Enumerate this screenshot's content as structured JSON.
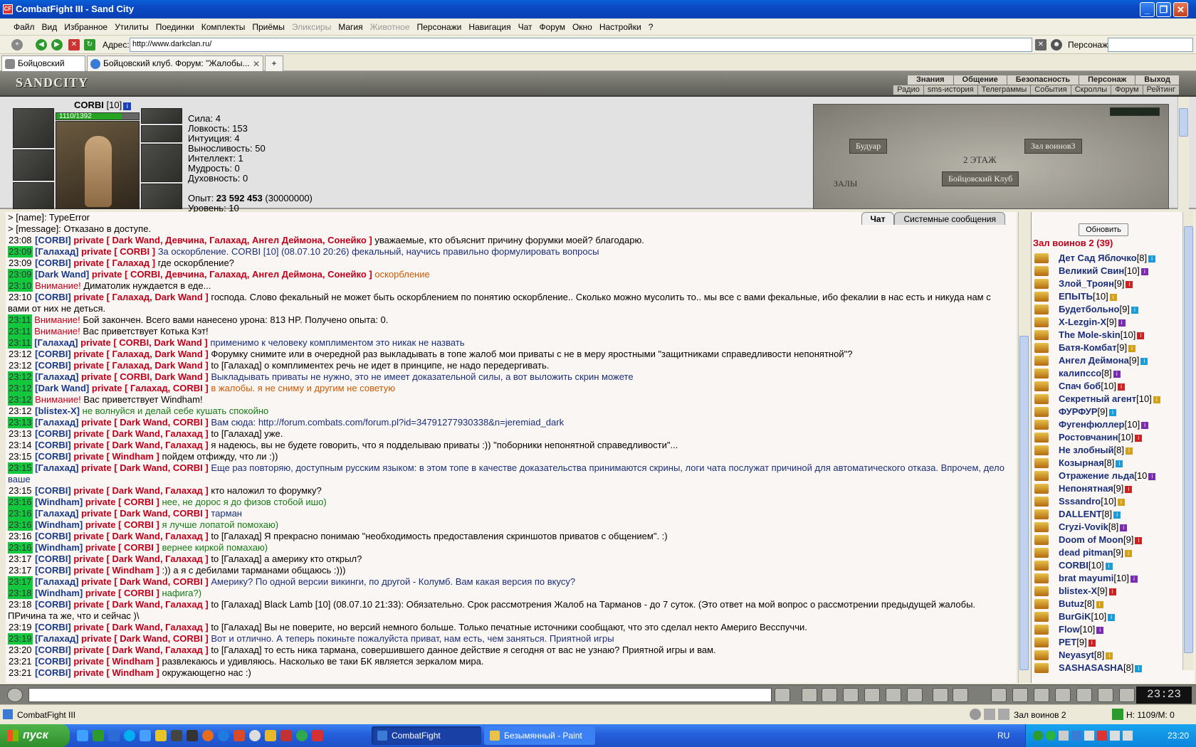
{
  "window": {
    "title": "CombatFight III - Sand City"
  },
  "menu": [
    {
      "label": "Файл"
    },
    {
      "label": "Вид"
    },
    {
      "label": "Избранное"
    },
    {
      "label": "Утилиты"
    },
    {
      "label": "Поединки"
    },
    {
      "label": "Комплекты"
    },
    {
      "label": "Приёмы"
    },
    {
      "label": "Эликсиры",
      "disabled": true
    },
    {
      "label": "Магия"
    },
    {
      "label": "Животное",
      "disabled": true
    },
    {
      "label": "Персонажи"
    },
    {
      "label": "Навигация"
    },
    {
      "label": "Чат"
    },
    {
      "label": "Форум"
    },
    {
      "label": "Окно"
    },
    {
      "label": "Настройки"
    },
    {
      "label": "?"
    }
  ],
  "address": {
    "label": "Адрес:",
    "value": "http://www.darkclan.ru/",
    "persona_label": "Персонаж:"
  },
  "tabs": [
    {
      "label": "Бойцовский клуб"
    },
    {
      "label": "Бойцовский клуб. Форум: \"Жалобы..."
    }
  ],
  "game": {
    "logo": "SANDCITY",
    "nav_top": [
      "Знания",
      "Общение",
      "Безопасность",
      "Персонаж",
      "Выход"
    ],
    "nav_bottom": [
      "Радио",
      "sms-история",
      "Телеграммы",
      "События",
      "Скроллы",
      "Форум",
      "Рейтинг"
    ]
  },
  "character": {
    "name": "CORBI",
    "level": "[10]",
    "hp_text": "1110/1392",
    "hp_fraction": 0.797,
    "stats": [
      "Сила: 4",
      "Ловкость: 153",
      "Интуиция: 4",
      "Выносливость: 50",
      "Интеллект: 1",
      "Мудрость: 0",
      "Духовность: 0"
    ],
    "exp_label": "Опыт:",
    "exp_value": "23 592 453",
    "exp_next": "(30000000)",
    "level_line": "Уровень: 10"
  },
  "map": {
    "left": "Будуар",
    "right": "Зал воинов3",
    "floor": "2 ЭТАЖ",
    "bottom_left": "ЗАЛЫ",
    "center": "Бойцовский Клуб"
  },
  "chat": {
    "tabs": [
      "Чат",
      "Системные сообщения"
    ],
    "messages": [
      {
        "segs": [
          {
            "c": "sys",
            "t": "> [name]: TypeError"
          }
        ]
      },
      {
        "segs": [
          {
            "c": "sys",
            "t": "> [message]: Отказано в доступе."
          }
        ]
      },
      {
        "time": "23:08",
        "hl": false,
        "segs": [
          {
            "c": "nick",
            "t": "[CORBI] "
          },
          {
            "c": "priv",
            "t": "private [ Dark Wand, Девчина, Галахад, Ангел Деймона, Сонейко ] "
          },
          {
            "c": "sys",
            "t": "уважаемые, кто объяснит причину форумки моей? благодарю."
          }
        ]
      },
      {
        "time": "23:09",
        "hl": true,
        "segs": [
          {
            "c": "nick",
            "t": "[Галахад] "
          },
          {
            "c": "priv",
            "t": "private [ CORBI ] "
          },
          {
            "c": "blue",
            "t": "За оскорбление. CORBI [10] (08.07.10 20:26) фекальный, научись правильно формулировать вопросы"
          }
        ]
      },
      {
        "time": "23:09",
        "hl": false,
        "segs": [
          {
            "c": "nick",
            "t": "[CORBI] "
          },
          {
            "c": "priv",
            "t": "private [ Галахад ] "
          },
          {
            "c": "sys",
            "t": "где оскорбление?"
          }
        ]
      },
      {
        "time": "23:09",
        "hl": true,
        "segs": [
          {
            "c": "nick",
            "t": "[Dark Wand] "
          },
          {
            "c": "priv",
            "t": "private [ CORBI, Девчина, Галахад, Ангел Деймона, Сонейко ] "
          },
          {
            "c": "orange",
            "t": "оскорбление"
          }
        ]
      },
      {
        "time": "23:10",
        "hl": true,
        "segs": [
          {
            "c": "red",
            "t": "Внимание! "
          },
          {
            "c": "sys",
            "t": "Диматолик нуждается в еде..."
          }
        ]
      },
      {
        "time": "23:10",
        "hl": false,
        "segs": [
          {
            "c": "nick",
            "t": "[CORBI] "
          },
          {
            "c": "priv",
            "t": "private [ Галахад, Dark Wand ] "
          },
          {
            "c": "sys",
            "t": "господа. Слово фекальный не может быть оскорблением по понятию оскорбление.. Сколько можно мусолить то.. мы все с вами фекальные, ибо фекалии в нас есть и никуда нам с вами от них не деться."
          }
        ]
      },
      {
        "time": "23:11",
        "hl": true,
        "segs": [
          {
            "c": "red",
            "t": "Внимание! "
          },
          {
            "c": "sys",
            "t": "Бой закончен. Всего вами нанесено урона: 813 HP. Получено опыта: 0."
          }
        ]
      },
      {
        "time": "23:11",
        "hl": true,
        "segs": [
          {
            "c": "red",
            "t": "Внимание! "
          },
          {
            "c": "sys",
            "t": "Вас приветствует Котька Кэт!"
          }
        ]
      },
      {
        "time": "23:11",
        "hl": true,
        "segs": [
          {
            "c": "nick",
            "t": "[Галахад] "
          },
          {
            "c": "priv",
            "t": "private [ CORBI, Dark Wand ] "
          },
          {
            "c": "blue",
            "t": "применимо к человеку комплиментом это никак не назвать"
          }
        ]
      },
      {
        "time": "23:12",
        "hl": false,
        "segs": [
          {
            "c": "nick",
            "t": "[CORBI] "
          },
          {
            "c": "priv",
            "t": "private [ Галахад, Dark Wand ] "
          },
          {
            "c": "sys",
            "t": "Форумку снимите или в очередной раз выкладывать в топе жалоб мои приваты с не в меру яростными \"защитниками справедливости непонятной\"?"
          }
        ]
      },
      {
        "time": "23:12",
        "hl": false,
        "segs": [
          {
            "c": "nick",
            "t": "[CORBI] "
          },
          {
            "c": "priv",
            "t": "private [ Галахад, Dark Wand ] "
          },
          {
            "c": "sys",
            "t": "to [Галахад] о комплиментех речь не идет в принципе, не надо передергивать."
          }
        ]
      },
      {
        "time": "23:12",
        "hl": true,
        "segs": [
          {
            "c": "nick",
            "t": "[Галахад] "
          },
          {
            "c": "priv",
            "t": "private [ CORBI, Dark Wand ] "
          },
          {
            "c": "blue",
            "t": "Выкладывать приваты не нужно, это не имеет доказательной силы, а вот выложить скрин можете"
          }
        ]
      },
      {
        "time": "23:12",
        "hl": true,
        "segs": [
          {
            "c": "nick",
            "t": "[Dark Wand] "
          },
          {
            "c": "priv",
            "t": "private [ Галахад, CORBI ] "
          },
          {
            "c": "orange",
            "t": "в жалобы. я не сниму и другим не советую"
          }
        ]
      },
      {
        "time": "23:12",
        "hl": true,
        "segs": [
          {
            "c": "red",
            "t": "Внимание! "
          },
          {
            "c": "sys",
            "t": "Вас приветствует Windham!"
          }
        ]
      },
      {
        "time": "23:12",
        "hl": false,
        "segs": [
          {
            "c": "nick",
            "t": "[blistex-X] "
          },
          {
            "c": "green",
            "t": "не волнуйся и делай себе кушать спокойно"
          }
        ]
      },
      {
        "time": "23:13",
        "hl": true,
        "segs": [
          {
            "c": "nick",
            "t": "[Галахад] "
          },
          {
            "c": "priv",
            "t": "private [ Dark Wand, CORBI ] "
          },
          {
            "c": "blue",
            "t": "Вам сюда: http://forum.combats.com/forum.pl?id=34791277930338&n=jeremiad_dark"
          }
        ]
      },
      {
        "time": "23:13",
        "hl": false,
        "segs": [
          {
            "c": "nick",
            "t": "[CORBI] "
          },
          {
            "c": "priv",
            "t": "private [ Dark Wand, Галахад ] "
          },
          {
            "c": "sys",
            "t": "to [Галахад] уже."
          }
        ]
      },
      {
        "time": "23:14",
        "hl": false,
        "segs": [
          {
            "c": "nick",
            "t": "[CORBI] "
          },
          {
            "c": "priv",
            "t": "private [ Dark Wand, Галахад ] "
          },
          {
            "c": "sys",
            "t": "я надеюсь, вы не будете говорить, что я подделываю приваты :)) \"поборники непонятной справедливости\"..."
          }
        ]
      },
      {
        "time": "23:15",
        "hl": false,
        "segs": [
          {
            "c": "nick",
            "t": "[CORBI] "
          },
          {
            "c": "priv",
            "t": "private [ Windham ] "
          },
          {
            "c": "sys",
            "t": "пойдем отфиждy, что ли :))"
          }
        ]
      },
      {
        "time": "23:15",
        "hl": true,
        "segs": [
          {
            "c": "nick",
            "t": "[Галахад] "
          },
          {
            "c": "priv",
            "t": "private [ Dark Wand, CORBI ] "
          },
          {
            "c": "blue",
            "t": "Еще раз повторяю, доступным русским языком: в этом топе в качестве доказательства принимаются скрины, логи чата послужат причиной для автоматического отказа. Впрочем, дело ваше"
          }
        ]
      },
      {
        "time": "23:15",
        "hl": false,
        "segs": [
          {
            "c": "nick",
            "t": "[CORBI] "
          },
          {
            "c": "priv",
            "t": "private [ Dark Wand, Галахад ] "
          },
          {
            "c": "sys",
            "t": "кто наложил то форумку?"
          }
        ]
      },
      {
        "time": "23:16",
        "hl": true,
        "segs": [
          {
            "c": "nick",
            "t": "[Windham] "
          },
          {
            "c": "priv",
            "t": "private [ CORBI ] "
          },
          {
            "c": "green",
            "t": "нее, не дорос я до физов стобой ишо)"
          }
        ]
      },
      {
        "time": "23:16",
        "hl": true,
        "segs": [
          {
            "c": "nick",
            "t": "[Галахад] "
          },
          {
            "c": "priv",
            "t": "private [ Dark Wand, CORBI ] "
          },
          {
            "c": "blue",
            "t": "тарман"
          }
        ]
      },
      {
        "time": "23:16",
        "hl": true,
        "segs": [
          {
            "c": "nick",
            "t": "[Windham] "
          },
          {
            "c": "priv",
            "t": "private [ CORBI ] "
          },
          {
            "c": "green",
            "t": "я лучше лопатой помохаю)"
          }
        ]
      },
      {
        "time": "23:16",
        "hl": false,
        "segs": [
          {
            "c": "nick",
            "t": "[CORBI] "
          },
          {
            "c": "priv",
            "t": "private [ Dark Wand, Галахад ] "
          },
          {
            "c": "sys",
            "t": "to [Галахад] Я прекрасно понимаю \"необходимость предоставления скриншотов приватов с общением\". :)"
          }
        ]
      },
      {
        "time": "23:16",
        "hl": true,
        "segs": [
          {
            "c": "nick",
            "t": "[Windham] "
          },
          {
            "c": "priv",
            "t": "private [ CORBI ] "
          },
          {
            "c": "green",
            "t": "вернее киркой помахаю)"
          }
        ]
      },
      {
        "time": "23:17",
        "hl": false,
        "segs": [
          {
            "c": "nick",
            "t": "[CORBI] "
          },
          {
            "c": "priv",
            "t": "private [ Dark Wand, Галахад ] "
          },
          {
            "c": "sys",
            "t": "to [Галахад] а америку кто открыл?"
          }
        ]
      },
      {
        "time": "23:17",
        "hl": false,
        "segs": [
          {
            "c": "nick",
            "t": "[CORBI] "
          },
          {
            "c": "priv",
            "t": "private [ Windham ] "
          },
          {
            "c": "sys",
            "t": ":)) а я с дебилами тарманами общаюсь :)))"
          }
        ]
      },
      {
        "time": "23:17",
        "hl": true,
        "segs": [
          {
            "c": "nick",
            "t": "[Галахад] "
          },
          {
            "c": "priv",
            "t": "private [ Dark Wand, CORBI ] "
          },
          {
            "c": "blue",
            "t": "Америку? По одной версии викинги, по другой - Колумб. Вам какая версия по вкусу?"
          }
        ]
      },
      {
        "time": "23:18",
        "hl": true,
        "segs": [
          {
            "c": "nick",
            "t": "[Windham] "
          },
          {
            "c": "priv",
            "t": "private [ CORBI ] "
          },
          {
            "c": "green",
            "t": "нафига?)"
          }
        ]
      },
      {
        "time": "23:18",
        "hl": false,
        "segs": [
          {
            "c": "nick",
            "t": "[CORBI] "
          },
          {
            "c": "priv",
            "t": "private [ Dark Wand, Галахад ] "
          },
          {
            "c": "sys",
            "t": "to [Галахад] Black Lamb [10] (08.07.10 21:33): Обязательно. Срок рассмотрения Жалоб на Тарманов - до 7 суток. (Это ответ на мой вопрос о рассмотрении предыдущей жалобы. ПРичина та же, что и сейчас )\\"
          }
        ]
      },
      {
        "time": "23:19",
        "hl": false,
        "segs": [
          {
            "c": "nick",
            "t": "[CORBI] "
          },
          {
            "c": "priv",
            "t": "private [ Dark Wand, Галахад ] "
          },
          {
            "c": "sys",
            "t": "to [Галахад] Вы не поверите, но версий немного больше. Только печатные источники сообщают, что это сделал некто Америго Весспуччи."
          }
        ]
      },
      {
        "time": "23:19",
        "hl": true,
        "segs": [
          {
            "c": "nick",
            "t": "[Галахад] "
          },
          {
            "c": "priv",
            "t": "private [ Dark Wand, CORBI ] "
          },
          {
            "c": "blue",
            "t": "Вот и отлично. А теперь покиньте пожалуйста приват, нам есть, чем заняться. Приятной игры"
          }
        ]
      },
      {
        "time": "23:20",
        "hl": false,
        "segs": [
          {
            "c": "nick",
            "t": "[CORBI] "
          },
          {
            "c": "priv",
            "t": "private [ Dark Wand, Галахад ] "
          },
          {
            "c": "sys",
            "t": "to [Галахад] то есть ника тармана, совершившего данное действие я сегодня от вас не узнаю? Приятной игры и вам."
          }
        ]
      },
      {
        "time": "23:21",
        "hl": false,
        "segs": [
          {
            "c": "nick",
            "t": "[CORBI] "
          },
          {
            "c": "priv",
            "t": "private [ Windham ] "
          },
          {
            "c": "sys",
            "t": "развлекаюсь и удивляюсь. Насколько ве таки БК является зеркалом мира."
          }
        ]
      },
      {
        "time": "23:21",
        "hl": false,
        "segs": [
          {
            "c": "nick",
            "t": "[CORBI] "
          },
          {
            "c": "priv",
            "t": "private [ Windham ] "
          },
          {
            "c": "sys",
            "t": "окружающегно нас :)"
          }
        ]
      }
    ]
  },
  "players": {
    "refresh": "Обновить",
    "room": "Зал воинов 2 (39)",
    "list": [
      {
        "name": "Дет Сад Яблочко",
        "lvl": "[8]"
      },
      {
        "name": "Великий Свин",
        "lvl": "[10]"
      },
      {
        "name": "Злой_Троян",
        "lvl": "[9]"
      },
      {
        "name": "ЕПЫТЬ",
        "lvl": "[10]"
      },
      {
        "name": "Будетбольно",
        "lvl": "[9]"
      },
      {
        "name": "X-Lezgin-X",
        "lvl": "[9]"
      },
      {
        "name": "The Mole-skin",
        "lvl": "[10]"
      },
      {
        "name": "Батя-Комбат",
        "lvl": "[9]"
      },
      {
        "name": "Ангел Деймона",
        "lvl": "[9]"
      },
      {
        "name": "калипссо",
        "lvl": "[8]"
      },
      {
        "name": "Спач боб",
        "lvl": "[10]"
      },
      {
        "name": "Секретный агент",
        "lvl": "[10]"
      },
      {
        "name": "ФУРФУР",
        "lvl": "[9]"
      },
      {
        "name": "Фугенфюллер",
        "lvl": "[10]"
      },
      {
        "name": "Ростовчанин",
        "lvl": "[10]"
      },
      {
        "name": "Не злобный",
        "lvl": "[8]"
      },
      {
        "name": "Козырная",
        "lvl": "[8]"
      },
      {
        "name": "Отражение льда",
        "lvl": "[10"
      },
      {
        "name": "Непонятная",
        "lvl": "[9]"
      },
      {
        "name": "Sssandro",
        "lvl": "[10]"
      },
      {
        "name": "DALLENT",
        "lvl": "[8]"
      },
      {
        "name": "Cryzi-Vovik",
        "lvl": "[8]"
      },
      {
        "name": "Doom of Moon",
        "lvl": "[9]"
      },
      {
        "name": "dead pitman",
        "lvl": "[9]"
      },
      {
        "name": "CORBI",
        "lvl": "[10]"
      },
      {
        "name": "brat mayumi",
        "lvl": "[10]"
      },
      {
        "name": "blistex-X",
        "lvl": "[9]"
      },
      {
        "name": "Butuz",
        "lvl": "[8]"
      },
      {
        "name": "BurGiK",
        "lvl": "[10]"
      },
      {
        "name": "Flow",
        "lvl": "[10]"
      },
      {
        "name": "PET",
        "lvl": "[9]"
      },
      {
        "name": "Neyasyt",
        "lvl": "[8]"
      },
      {
        "name": "SASHASASHA",
        "lvl": "[8]"
      }
    ]
  },
  "clock": {
    "time": "23:23"
  },
  "status": {
    "left": "CombatFight III",
    "room": "Зал воинов 2",
    "hp": "H: 1109/M: 0"
  },
  "taskbar": {
    "start": "пуск",
    "tasks": [
      "CombatFight",
      "Безымянный - Paint"
    ],
    "lang": "RU",
    "time": "23:20"
  }
}
